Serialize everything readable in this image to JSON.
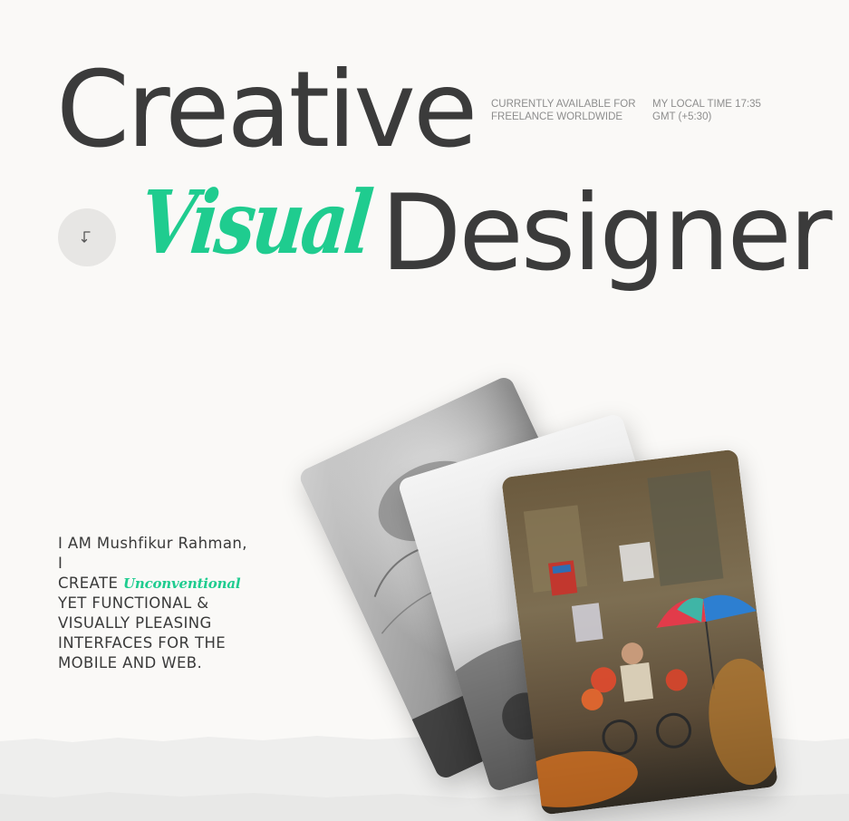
{
  "hero": {
    "line1": "Creative",
    "accent_word": "Visual",
    "line2": "Designer"
  },
  "meta": {
    "availability_line1": "CURRENTLY AVAILABLE FOR",
    "availability_line2": "FREELANCE WORLDWIDE",
    "time_line1": "MY LOCAL TIME 17:35",
    "time_line2": "GMT (+5:30)"
  },
  "scroll_button": {
    "icon": "arrow-down-left-icon"
  },
  "intro": {
    "line1": "I AM Mushfikur Rahman,",
    "line2": "I",
    "line3_prefix": "CREATE",
    "accent": "Unconventional",
    "line4": "YET FUNCTIONAL &",
    "line5": "VISUALLY PLEASING",
    "line6": "INTERFACES FOR THE",
    "line7": "MOBILE AND WEB."
  },
  "gallery": {
    "cards": [
      {
        "name": "portrait-photo-card",
        "tone": "grayscale"
      },
      {
        "name": "abstract-photo-card",
        "tone": "grayscale"
      },
      {
        "name": "street-market-photo-card",
        "tone": "color"
      }
    ]
  },
  "colors": {
    "background": "#faf9f7",
    "text": "#3b3b3b",
    "accent": "#1fcc8f",
    "muted": "#8d8d8d",
    "button_bg": "#e7e6e4"
  }
}
